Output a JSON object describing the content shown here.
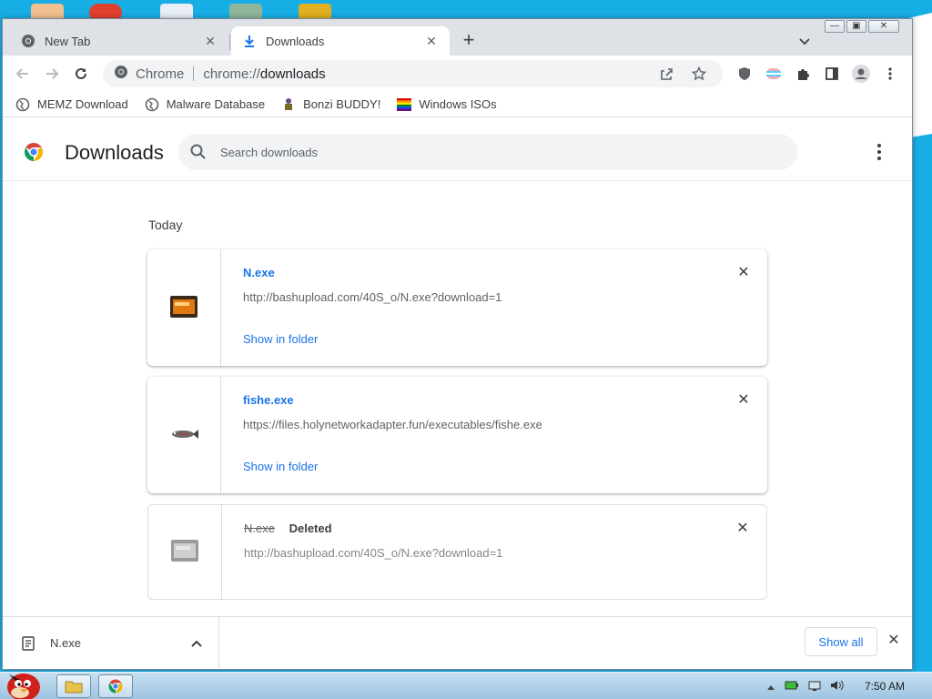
{
  "tabs": [
    {
      "title": "New Tab",
      "icon": "chrome-icon",
      "active": false
    },
    {
      "title": "Downloads",
      "icon": "download-icon",
      "active": true
    }
  ],
  "omnibox": {
    "chip": "Chrome",
    "scheme": "chrome://",
    "host": "downloads"
  },
  "bookmarks": [
    {
      "label": "MEMZ Download",
      "icon": "globe-icon"
    },
    {
      "label": "Malware Database",
      "icon": "globe-icon"
    },
    {
      "label": "Bonzi BUDDY!",
      "icon": "bonzi-icon"
    },
    {
      "label": "Windows ISOs",
      "icon": "rainbow-flag-icon"
    }
  ],
  "downloads_page": {
    "title": "Downloads",
    "search_placeholder": "Search downloads",
    "date_heading": "Today",
    "items": [
      {
        "name": "N.exe",
        "url": "http://bashupload.com/40S_o/N.exe?download=1",
        "action": "Show in folder",
        "status": ""
      },
      {
        "name": "fishe.exe",
        "url": "https://files.holynetworkadapter.fun/executables/fishe.exe",
        "action": "Show in folder",
        "status": ""
      },
      {
        "name": "N.exe",
        "url": "http://bashupload.com/40S_o/N.exe?download=1",
        "action": "",
        "status": "Deleted"
      }
    ]
  },
  "shelf": {
    "item_name": "N.exe",
    "show_all_label": "Show all"
  },
  "taskbar": {
    "clock": "7:50 AM"
  },
  "colors": {
    "accent": "#1a73e8",
    "tab_strip": "#dee1e6",
    "desktop": "#17aee6"
  }
}
